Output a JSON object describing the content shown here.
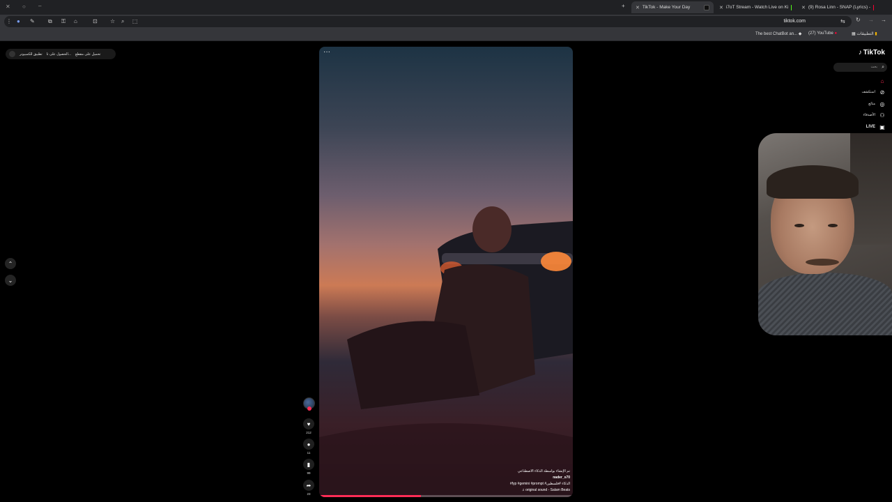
{
  "browser": {
    "tabs": [
      {
        "title": "TikTok - Make Your Day",
        "active": true
      },
      {
        "title": "i7oT Stream - Watch Live on Ki",
        "active": false
      },
      {
        "title": "(9) Rosa Linn - SNAP (Lyrics) -",
        "active": false
      }
    ],
    "url": "tiktok.com",
    "bookmarks": [
      {
        "label": "The best ChatBot an..."
      },
      {
        "label": "(27) YouTube"
      },
      {
        "label": "التطبيقات"
      }
    ]
  },
  "extension_bar": {
    "items": [
      "تحميل على مقطع",
      "الحصول على تا...",
      "تطبيق للكمبيوتر"
    ]
  },
  "sidebar": {
    "logo": "TikTok",
    "search_placeholder": "بحث",
    "items": [
      {
        "label": "",
        "icon": "home-icon"
      },
      {
        "label": "استكشف",
        "icon": "compass-icon"
      },
      {
        "label": "متابَع",
        "icon": "following-icon"
      },
      {
        "label": "الأصدقاء",
        "icon": "friends-icon"
      },
      {
        "label": "LIVE",
        "icon": "live-icon"
      },
      {
        "label": "",
        "icon": "messages-icon"
      }
    ]
  },
  "video": {
    "more_label": "···",
    "caption": {
      "ai_label": "تم الإنشاء بواسطة الذكاء الاصطناعي",
      "username": "nader_s70",
      "hashtags": "#fyp #gemini #prompt #الذكاء #فلسطين",
      "sound": "♫ original sound - Salam Beats"
    },
    "progress": 0.4
  },
  "actions": {
    "likes": "212",
    "comments": "11",
    "saves": "99",
    "shares": "23"
  },
  "colors": {
    "accent": "#fe2c55",
    "background": "#000000",
    "chrome": "#35363a"
  }
}
